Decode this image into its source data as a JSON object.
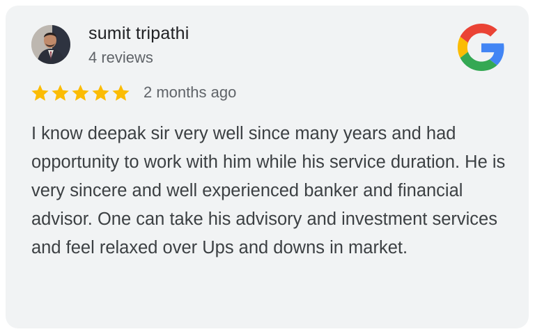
{
  "review": {
    "author_name": "sumit tripathi",
    "author_review_count": "4 reviews",
    "rating": 5,
    "rating_max": 5,
    "time_ago": "2 months ago",
    "text": "I know deepak sir very well since many years and had opportunity to work with him while his service duration. He is very sincere and well experienced banker and financial advisor. One can take his advisory and investment services and feel relaxed over Ups and downs in market."
  },
  "icons": {
    "star": "star-icon",
    "brand": "google-logo-icon"
  },
  "colors": {
    "card_background": "#f1f3f4",
    "star": "#fbbc04",
    "google_blue": "#4285f4",
    "google_red": "#ea4335",
    "google_yellow": "#fbbc05",
    "google_green": "#34a853"
  }
}
